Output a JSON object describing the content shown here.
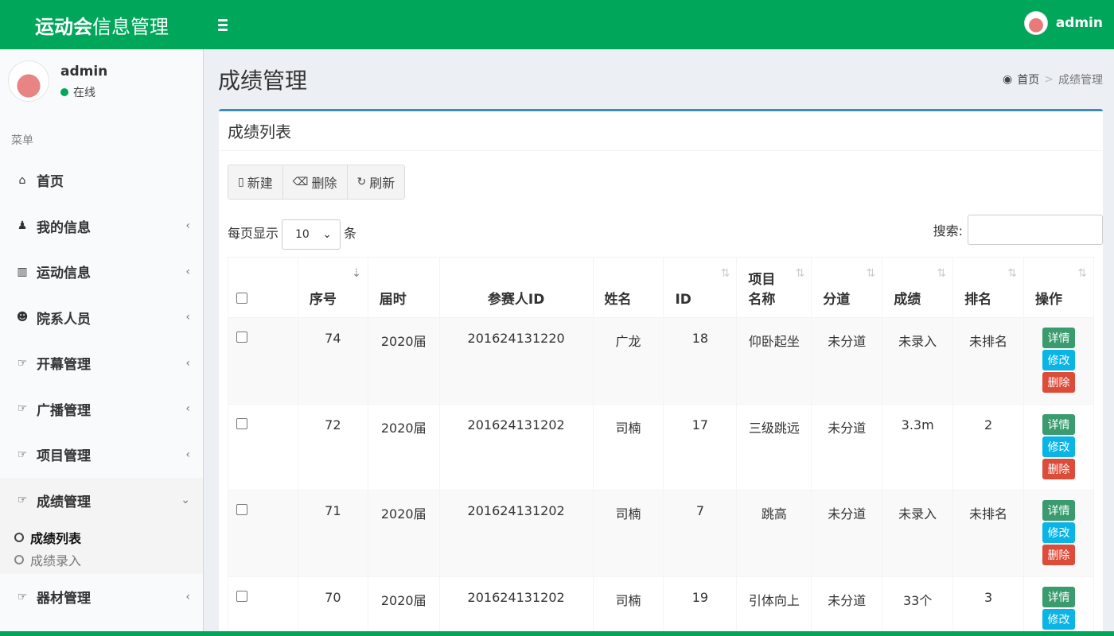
{
  "header": {
    "brand_bold": "运动会",
    "brand_rest": "信息管理",
    "user": "admin"
  },
  "sidebar": {
    "user_name": "admin",
    "status": "在线",
    "menu_header": "菜单",
    "items": [
      {
        "label": "首页",
        "icon": "home-icon",
        "glyph": "⌂"
      },
      {
        "label": "我的信息",
        "icon": "user-icon",
        "glyph": "♟"
      },
      {
        "label": "运动信息",
        "icon": "bar-chart-icon",
        "glyph": "▥"
      },
      {
        "label": "院系人员",
        "icon": "users-icon",
        "glyph": "☻"
      },
      {
        "label": "开幕管理",
        "icon": "hand-pointer-icon",
        "glyph": "☞"
      },
      {
        "label": "广播管理",
        "icon": "hand-pointer-icon",
        "glyph": "☞"
      },
      {
        "label": "项目管理",
        "icon": "hand-pointer-icon",
        "glyph": "☞"
      },
      {
        "label": "成绩管理",
        "icon": "hand-pointer-icon",
        "glyph": "☞"
      },
      {
        "label": "器材管理",
        "icon": "hand-pointer-icon",
        "glyph": "☞"
      }
    ],
    "submenu": [
      {
        "label": "成绩列表"
      },
      {
        "label": "成绩录入"
      }
    ]
  },
  "content": {
    "page_title": "成绩管理",
    "breadcrumb_home": "首页",
    "breadcrumb_current": "成绩管理",
    "box_title": "成绩列表",
    "toolbar": {
      "new": "新建",
      "delete": "删除",
      "refresh": "刷新"
    },
    "length": {
      "prefix": "每页显示",
      "value": "10",
      "suffix": "条"
    },
    "search_label": "搜索:"
  },
  "table": {
    "columns": [
      "序号",
      "届时",
      "参赛人ID",
      "姓名",
      "ID",
      "项目名称",
      "分道",
      "成绩",
      "排名",
      "操作"
    ],
    "rows": [
      {
        "seq": "74",
        "session": "2020届",
        "pid": "201624131220",
        "name": "广龙",
        "id": "18",
        "event": "仰卧起坐",
        "lane": "未分道",
        "score": "未录入",
        "rank": "未排名"
      },
      {
        "seq": "72",
        "session": "2020届",
        "pid": "201624131202",
        "name": "司楠",
        "id": "17",
        "event": "三级跳远",
        "lane": "未分道",
        "score": "3.3m",
        "rank": "2"
      },
      {
        "seq": "71",
        "session": "2020届",
        "pid": "201624131202",
        "name": "司楠",
        "id": "7",
        "event": "跳高",
        "lane": "未分道",
        "score": "未录入",
        "rank": "未排名"
      },
      {
        "seq": "70",
        "session": "2020届",
        "pid": "201624131202",
        "name": "司楠",
        "id": "19",
        "event": "引体向上",
        "lane": "未分道",
        "score": "33个",
        "rank": "3"
      }
    ],
    "actions": {
      "detail": "详情",
      "edit": "修改",
      "delete": "删除"
    }
  }
}
